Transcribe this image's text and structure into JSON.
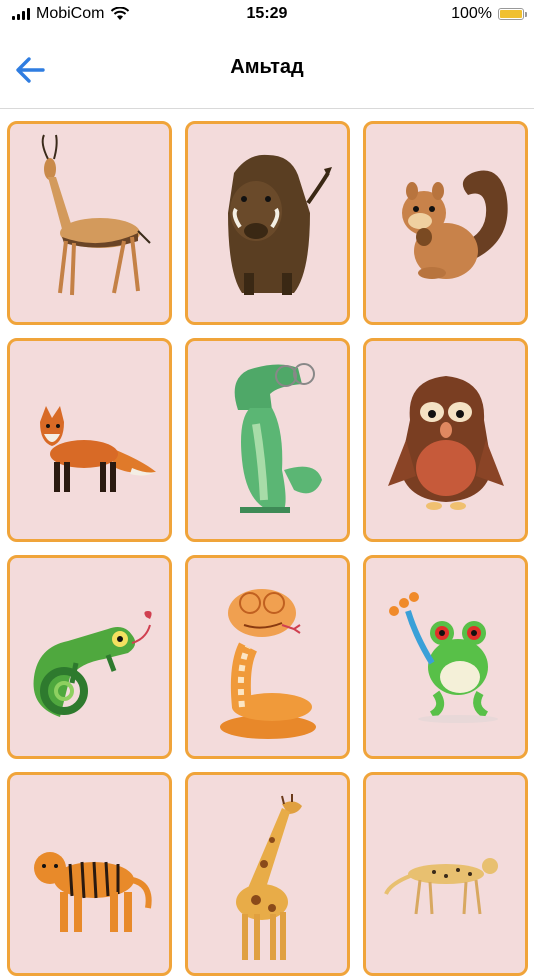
{
  "status_bar": {
    "carrier": "MobiCom",
    "time": "15:29",
    "battery": "100%",
    "battery_color": "#f0c030"
  },
  "header": {
    "title": "Амьтад",
    "back_icon": "arrow-left-icon",
    "accent_color": "#2f7de1"
  },
  "card_style": {
    "background": "#f3dbdb",
    "border": "#f0a43a"
  },
  "animals": [
    {
      "name": "gazelle"
    },
    {
      "name": "warthog"
    },
    {
      "name": "squirrel"
    },
    {
      "name": "fox"
    },
    {
      "name": "crocodile"
    },
    {
      "name": "owl"
    },
    {
      "name": "chameleon"
    },
    {
      "name": "snake"
    },
    {
      "name": "frog"
    },
    {
      "name": "tiger"
    },
    {
      "name": "giraffe"
    },
    {
      "name": "cheetah"
    }
  ]
}
